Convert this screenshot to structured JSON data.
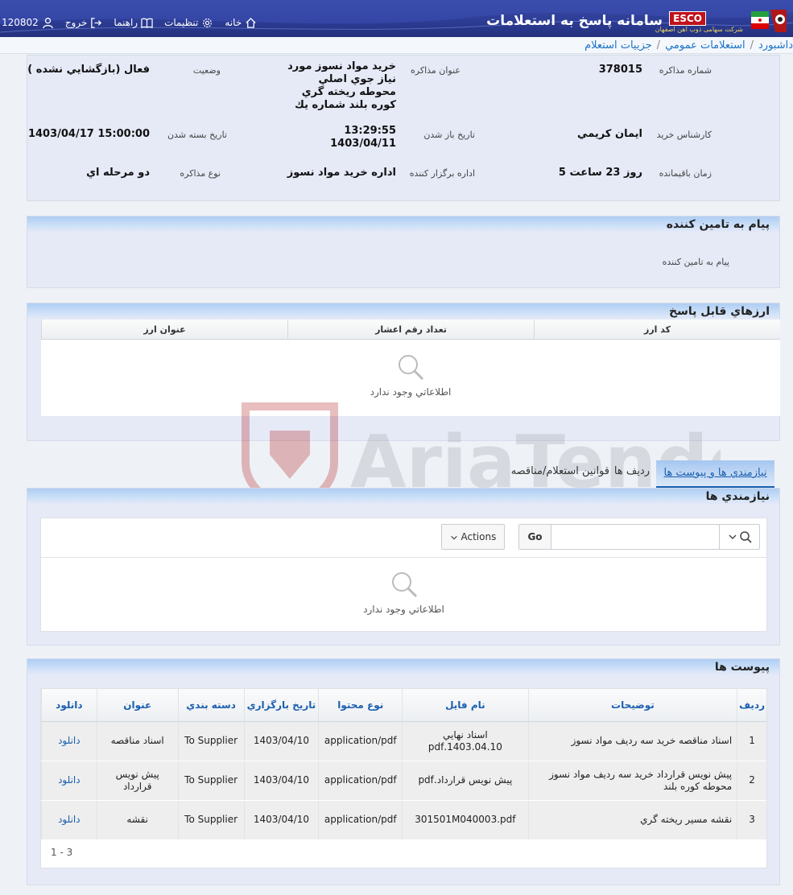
{
  "header": {
    "app_title": "سامانه پاسخ به استعلامات",
    "esco_label": "ESCO",
    "esco_sub": "شرکت سهامی ذوب آهن اصفهان",
    "nav": {
      "home": "خانه",
      "settings": "تنظیمات",
      "help": "راهنما",
      "logout": "خروج",
      "user_code": "120802"
    }
  },
  "breadcrumb": {
    "dashboard": "داشبورد",
    "public": "استعلامات عمومي",
    "current": "جزييات استعلام"
  },
  "info": {
    "number_label": "شماره مذاکره",
    "number_value": "378015",
    "title_label": "عنوان مذاکره",
    "title_value": "خريد مواد نسوز مورد نياز جوي اصلي محوطه ريخته گري کوره بلند شماره يك",
    "status_label": "وضعيت",
    "status_value": "فعال (بازگشايي نشده )",
    "expert_label": "کارشناس خريد",
    "expert_value": "ايمان کريمي",
    "open_label": "تاريخ باز شدن",
    "open_time": "13:29:55",
    "open_date": "1403/04/11",
    "close_label": "تاريخ بسته شدن",
    "close_value": "1403/04/17 15:00:00",
    "remaining_label": "زمان باقيمانده",
    "remaining_value": "5 روز 23 ساعت",
    "dept_label": "اداره برگزار کننده",
    "dept_value": "اداره خريد مواد نسوز",
    "type_label": "نوع مذاکره",
    "type_value": "دو مرحله اي"
  },
  "supplier_msg": {
    "title": "پيام به تامين کننده",
    "label": "پيام به تامين کننده"
  },
  "currencies": {
    "title": "ارزهاي قابل پاسخ",
    "columns": [
      "کد ارز",
      "تعداد رقم اعشار",
      "عنوان ارز"
    ],
    "empty": "اطلاعاتي وجود ندارد"
  },
  "tabs": {
    "needs": "نيازمندي ها و پيوست ها",
    "rows": "رديف ها",
    "rules": "قوانين استعلام/مناقصه"
  },
  "needs": {
    "title": "نيازمندي ها",
    "go": "Go",
    "actions": "Actions",
    "empty": "اطلاعاتي وجود ندارد"
  },
  "attachments": {
    "title": "پيوست ها",
    "columns": [
      "رديف",
      "توضيحات",
      "نام فايل",
      "نوع محتوا",
      "تاريخ بارگزاري",
      "دسته بندي",
      "عنوان",
      "دانلود"
    ],
    "rows": [
      {
        "idx": "1",
        "desc": "اسناد مناقصه خريد سه رديف مواد نسوز",
        "file": "اسناد نهايي 1403.04.10.pdf",
        "type": "application/pdf",
        "date": "1403/04/10",
        "cat": "To Supplier",
        "title": "اسناد مناقصه",
        "dl": "دانلود"
      },
      {
        "idx": "2",
        "desc": "پيش نويس قرارداد خريد سه رديف مواد نسوز محوطه کوره بلند",
        "file": "پيش نويس قرارداد.pdf",
        "type": "application/pdf",
        "date": "1403/04/10",
        "cat": "To Supplier",
        "title": "پيش نويس قرارداد",
        "dl": "دانلود"
      },
      {
        "idx": "3",
        "desc": "نقشه مسير ريخته گري",
        "file": "301501M040003.pdf",
        "type": "application/pdf",
        "date": "1403/04/10",
        "cat": "To Supplier",
        "title": "نقشه",
        "dl": "دانلود"
      }
    ],
    "pager": "1 - 3"
  },
  "watermark_text": "AriaTender.neT",
  "colors": {
    "header_bg": "#2d3d96",
    "link": "#1a5fb0",
    "panel_bg": "#e6eaf7",
    "esco_red": "#c0121b"
  }
}
